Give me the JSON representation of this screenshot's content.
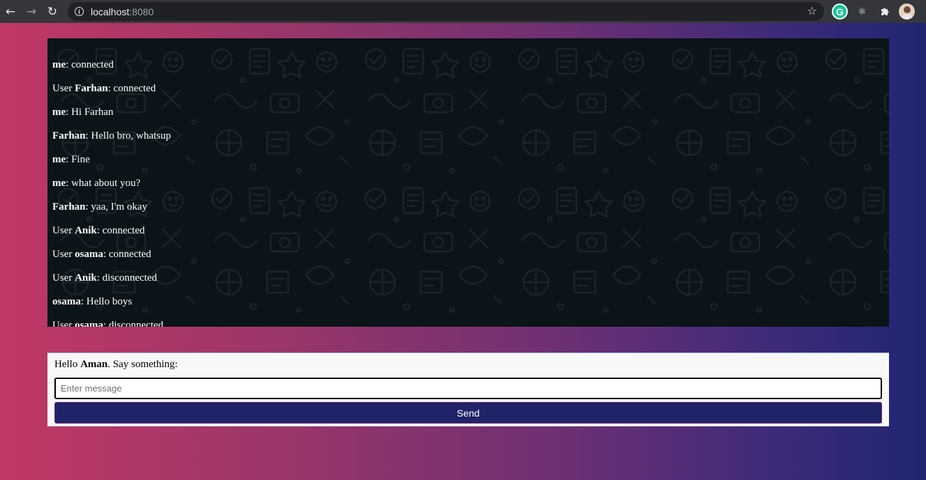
{
  "browser": {
    "url_host": "localhost",
    "url_port": ":8080",
    "icons": [
      "back-icon",
      "forward-icon",
      "reload-icon",
      "site-info-icon",
      "bookmark-star-icon",
      "grammarly-icon",
      "react-devtools-icon",
      "extensions-icon",
      "profile-avatar"
    ]
  },
  "chat": {
    "messages": [
      {
        "prefix": "",
        "name": "me",
        "text": ": connected"
      },
      {
        "prefix": "User ",
        "name": "Farhan",
        "text": ": connected"
      },
      {
        "prefix": "",
        "name": "me",
        "text": ": Hi Farhan"
      },
      {
        "prefix": "",
        "name": "Farhan",
        "text": ": Hello bro, whatsup"
      },
      {
        "prefix": "",
        "name": "me",
        "text": ": Fine"
      },
      {
        "prefix": "",
        "name": "me",
        "text": ": what about you?"
      },
      {
        "prefix": "",
        "name": "Farhan",
        "text": ": yaa, I'm okay"
      },
      {
        "prefix": "User ",
        "name": "Anik",
        "text": ": connected"
      },
      {
        "prefix": "User ",
        "name": "osama",
        "text": ": connected"
      },
      {
        "prefix": "User ",
        "name": "Anik",
        "text": ": disconnected"
      },
      {
        "prefix": "",
        "name": "osama",
        "text": ": Hello boys"
      },
      {
        "prefix": "User ",
        "name": "osama",
        "text": ": disconnected"
      }
    ]
  },
  "form": {
    "greeting_prefix": "Hello ",
    "username": "Aman",
    "greeting_suffix": ". Say something:",
    "input_placeholder": "Enter message",
    "input_value": "",
    "send_label": "Send"
  },
  "colors": {
    "gradient_start": "#c13866",
    "gradient_end": "#1f2672",
    "chat_bg": "#0b1418",
    "send_button": "#1f2468"
  }
}
